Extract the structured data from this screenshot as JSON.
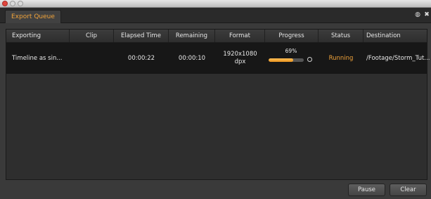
{
  "window": {
    "tab_title": "Export Queue"
  },
  "table": {
    "columns": [
      "Exporting",
      "Clip",
      "Elapsed Time",
      "Remaining",
      "Format",
      "Progress",
      "Status",
      "Destination"
    ],
    "rows": [
      {
        "exporting": "Timeline as sin...",
        "clip": "",
        "elapsed": "00:00:22",
        "remaining": "00:00:10",
        "format_line1": "1920x1080",
        "format_line2": "dpx",
        "progress_label": "69%",
        "progress_fraction": 0.69,
        "status": "Running",
        "destination": "/Footage/Storm_Tut..."
      }
    ]
  },
  "buttons": {
    "pause": "Pause",
    "clear": "Clear"
  },
  "colors": {
    "accent": "#f0a33a",
    "window_bg": "#3a3a3a",
    "panel_bg": "#2e2e2e",
    "row_bg": "#171717"
  },
  "icons": {
    "popout": "popout-icon",
    "close": "close-icon",
    "cancel": "cancel-ring-icon"
  }
}
